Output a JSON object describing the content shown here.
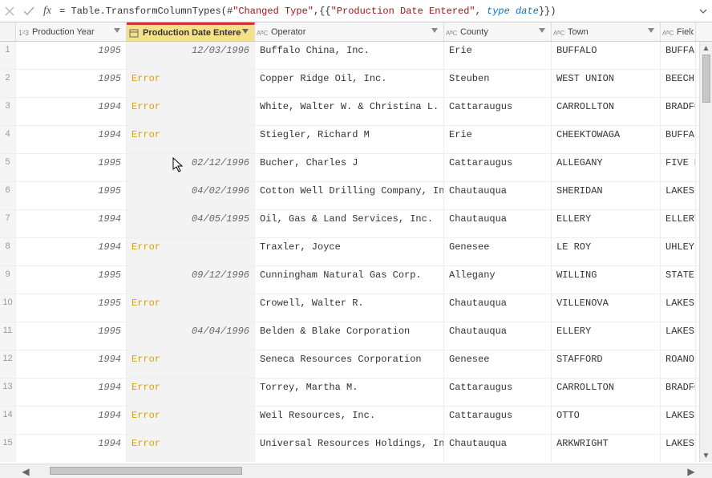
{
  "formula": {
    "prefix": "= Table.TransformColumnTypes(#",
    "arg1": "\"Changed Type\"",
    "mid": ",{{",
    "arg2": "\"Production Date Entered\"",
    "sep": ", ",
    "kw": "type date",
    "suffix": "}})"
  },
  "columns": {
    "year": "Production Year",
    "date": "Production Date Entered",
    "operator": "Operator",
    "county": "County",
    "town": "Town",
    "field": "Field"
  },
  "rows": [
    {
      "n": "1",
      "year": "1995",
      "date": "12/03/1996",
      "err": false,
      "op": "Buffalo China, Inc.",
      "county": "Erie",
      "town": "BUFFALO",
      "field": "BUFFALO"
    },
    {
      "n": "2",
      "year": "1995",
      "date": "Error",
      "err": true,
      "op": "Copper Ridge Oil, Inc.",
      "county": "Steuben",
      "town": "WEST UNION",
      "field": "BEECH H"
    },
    {
      "n": "3",
      "year": "1994",
      "date": "Error",
      "err": true,
      "op": "White, Walter W. & Christina L.",
      "county": "Cattaraugus",
      "town": "CARROLLTON",
      "field": "BRADFOR"
    },
    {
      "n": "4",
      "year": "1994",
      "date": "Error",
      "err": true,
      "op": "Stiegler, Richard M",
      "county": "Erie",
      "town": "CHEEKTOWAGA",
      "field": "BUFFALO"
    },
    {
      "n": "5",
      "year": "1995",
      "date": "02/12/1996",
      "err": false,
      "op": "Bucher, Charles J",
      "county": "Cattaraugus",
      "town": "ALLEGANY",
      "field": "FIVE MI"
    },
    {
      "n": "6",
      "year": "1995",
      "date": "04/02/1996",
      "err": false,
      "op": "Cotton Well Drilling Company,  Inc.",
      "county": "Chautauqua",
      "town": "SHERIDAN",
      "field": "LAKESHO"
    },
    {
      "n": "7",
      "year": "1994",
      "date": "04/05/1995",
      "err": false,
      "op": "Oil, Gas & Land Services, Inc.",
      "county": "Chautauqua",
      "town": "ELLERY",
      "field": "ELLERY"
    },
    {
      "n": "8",
      "year": "1994",
      "date": "Error",
      "err": true,
      "op": "Traxler, Joyce",
      "county": "Genesee",
      "town": "LE ROY",
      "field": "UHLEY ("
    },
    {
      "n": "9",
      "year": "1995",
      "date": "09/12/1996",
      "err": false,
      "op": "Cunningham Natural Gas Corp.",
      "county": "Allegany",
      "town": "WILLING",
      "field": "STATE I"
    },
    {
      "n": "10",
      "year": "1995",
      "date": "Error",
      "err": true,
      "op": "Crowell, Walter R.",
      "county": "Chautauqua",
      "town": "VILLENOVA",
      "field": "LAKESHO"
    },
    {
      "n": "11",
      "year": "1995",
      "date": "04/04/1996",
      "err": false,
      "op": "Belden & Blake Corporation",
      "county": "Chautauqua",
      "town": "ELLERY",
      "field": "LAKESHO"
    },
    {
      "n": "12",
      "year": "1994",
      "date": "Error",
      "err": true,
      "op": "Seneca Resources Corporation",
      "county": "Genesee",
      "town": "STAFFORD",
      "field": "ROANOKE"
    },
    {
      "n": "13",
      "year": "1994",
      "date": "Error",
      "err": true,
      "op": "Torrey, Martha M.",
      "county": "Cattaraugus",
      "town": "CARROLLTON",
      "field": "BRADFOR"
    },
    {
      "n": "14",
      "year": "1994",
      "date": "Error",
      "err": true,
      "op": "Weil Resources, Inc.",
      "county": "Cattaraugus",
      "town": "OTTO",
      "field": "LAKESHO"
    },
    {
      "n": "15",
      "year": "1994",
      "date": "Error",
      "err": true,
      "op": "Universal Resources Holdings, Incorp.",
      "county": "Chautauqua",
      "town": "ARKWRIGHT",
      "field": "LAKESHO"
    }
  ]
}
